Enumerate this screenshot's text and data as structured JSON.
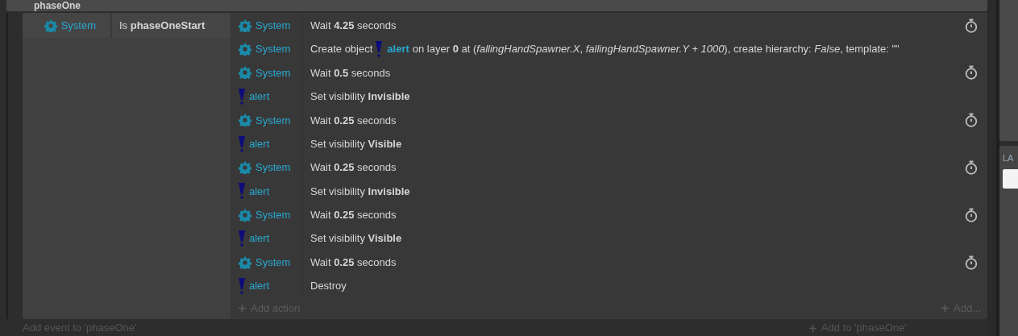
{
  "group": {
    "title": "phaseOne"
  },
  "event": {
    "conditions": [
      {
        "object": {
          "name": "System",
          "kind": "system"
        },
        "text": "Is **phaseOneStart**"
      }
    ],
    "actions": [
      {
        "object": {
          "name": "System",
          "kind": "system"
        },
        "kind": "wait",
        "text": "Wait **4.25** seconds"
      },
      {
        "object": {
          "name": "System",
          "kind": "system"
        },
        "kind": "create",
        "prefix": "Create object",
        "target": {
          "name": "alert",
          "kind": "sprite"
        },
        "text": "on layer **0** at (*fallingHandSpawner.X*, *fallingHandSpawner.Y + 1000*), create hierarchy: *False*, template: \"\""
      },
      {
        "object": {
          "name": "System",
          "kind": "system"
        },
        "kind": "wait",
        "text": "Wait **0.5** seconds"
      },
      {
        "object": {
          "name": "alert",
          "kind": "sprite"
        },
        "kind": "plain",
        "text": "Set visibility **Invisible**"
      },
      {
        "object": {
          "name": "System",
          "kind": "system"
        },
        "kind": "wait",
        "text": "Wait **0.25** seconds"
      },
      {
        "object": {
          "name": "alert",
          "kind": "sprite"
        },
        "kind": "plain",
        "text": "Set visibility **Visible**"
      },
      {
        "object": {
          "name": "System",
          "kind": "system"
        },
        "kind": "wait",
        "text": "Wait **0.25** seconds"
      },
      {
        "object": {
          "name": "alert",
          "kind": "sprite"
        },
        "kind": "plain",
        "text": "Set visibility **Invisible**"
      },
      {
        "object": {
          "name": "System",
          "kind": "system"
        },
        "kind": "wait",
        "text": "Wait **0.25** seconds"
      },
      {
        "object": {
          "name": "alert",
          "kind": "sprite"
        },
        "kind": "plain",
        "text": "Set visibility **Visible**"
      },
      {
        "object": {
          "name": "System",
          "kind": "system"
        },
        "kind": "wait",
        "text": "Wait **0.25** seconds"
      },
      {
        "object": {
          "name": "alert",
          "kind": "sprite"
        },
        "kind": "plain",
        "text": "Destroy"
      }
    ],
    "add_action": "Add action",
    "add_more": "Add..."
  },
  "add_event": "Add event to 'phaseOne'",
  "add_to_group": "Add to 'phaseOne'",
  "side_panel": {
    "label": "LA"
  }
}
